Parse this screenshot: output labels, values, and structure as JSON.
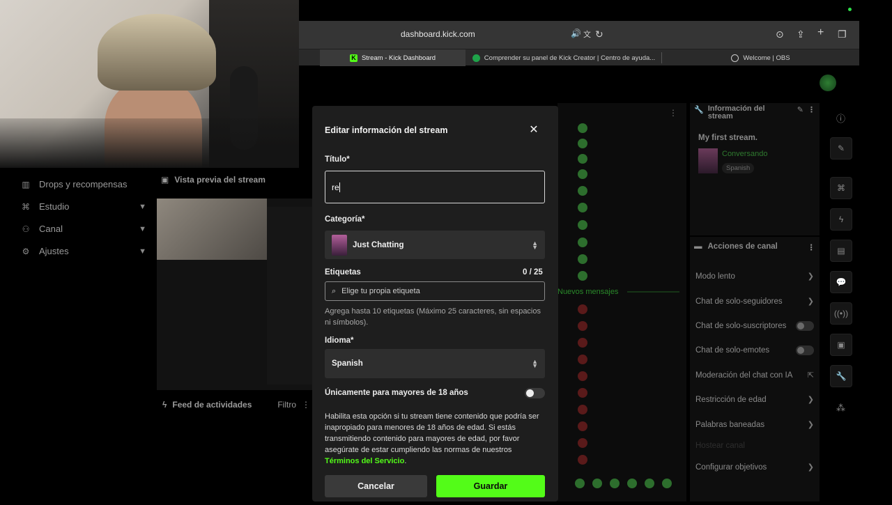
{
  "browser": {
    "url": "dashboard.kick.com",
    "tabs": [
      {
        "label": "Stream - Kick Dashboard",
        "active": true
      },
      {
        "label": "Comprender su panel de Kick Creator | Centro de ayuda...",
        "active": false
      },
      {
        "label": "Welcome | OBS",
        "active": false
      }
    ]
  },
  "sidebar": {
    "items": [
      {
        "label": "Drops y recompensas",
        "icon": "gift-icon"
      },
      {
        "label": "Estudio",
        "icon": "studio-icon"
      },
      {
        "label": "Canal",
        "icon": "users-icon"
      },
      {
        "label": "Ajustes",
        "icon": "gear-icon"
      }
    ]
  },
  "preview": {
    "title": "Vista previa del stream"
  },
  "activity": {
    "title": "Feed de actividades",
    "filter": "Filtro"
  },
  "chat": {
    "new_messages": "Nuevos mensajes"
  },
  "stream_info": {
    "title": "Información del stream",
    "stream_title": "My first stream.",
    "category": "Conversando",
    "language": "Spanish"
  },
  "channel_actions": {
    "title": "Acciones de canal",
    "items": [
      {
        "label": "Modo lento",
        "control": "chevron"
      },
      {
        "label": "Chat de solo-seguidores",
        "control": "chevron"
      },
      {
        "label": "Chat de solo-suscriptores",
        "control": "toggle"
      },
      {
        "label": "Chat de solo-emotes",
        "control": "toggle"
      },
      {
        "label": "Moderación del chat con IA",
        "control": "external"
      },
      {
        "label": "Restricción de edad",
        "control": "chevron"
      },
      {
        "label": "Palabras baneadas",
        "control": "chevron"
      },
      {
        "label": "Hostear canal",
        "control": "none"
      },
      {
        "label": "Configurar objetivos",
        "control": "chevron"
      }
    ]
  },
  "modal": {
    "title": "Editar información del stream",
    "title_label": "Título*",
    "title_value": "re",
    "category_label": "Categoría*",
    "category_value": "Just Chatting",
    "tags_label": "Etiquetas",
    "tags_count": "0 / 25",
    "tags_placeholder": "Elige tu propia etiqueta",
    "tags_help": "Agrega hasta 10 etiquetas (Máximo 25 caracteres, sin espacios ni símbolos).",
    "language_label": "Idioma*",
    "language_value": "Spanish",
    "adult_label": "Únicamente para mayores de 18 años",
    "adult_enabled": false,
    "adult_help": "Habilita esta opción si tu stream tiene contenido que podría ser inapropiado para menores de 18 años de edad. Si estás transmitiendo contenido para mayores de edad, por favor asegúrate de estar cumpliendo las normas de nuestros",
    "tos_link": "Términos del Servicio",
    "tos_suffix": ".",
    "cancel": "Cancelar",
    "save": "Guardar"
  },
  "colors": {
    "accent": "#53fc18",
    "background": "#000000",
    "modal": "#1e1e1e"
  }
}
